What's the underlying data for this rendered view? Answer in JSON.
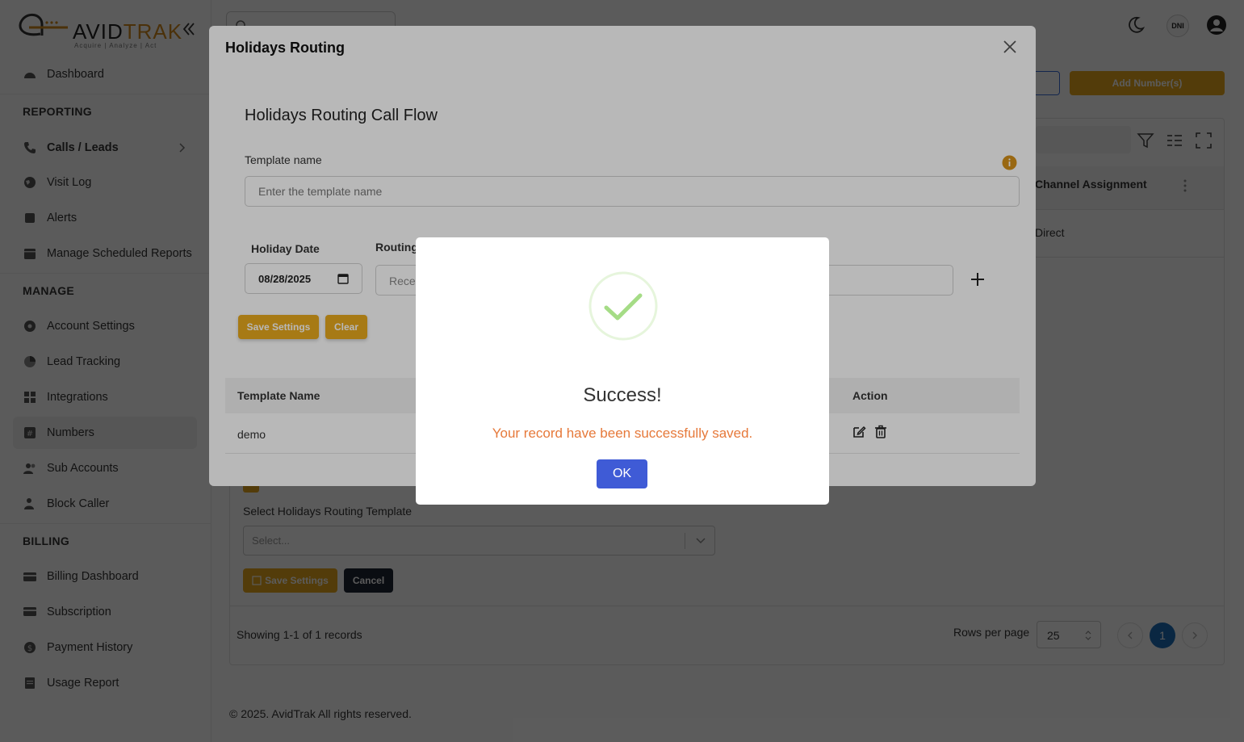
{
  "brand": {
    "name_prefix": "AVID",
    "name_suffix": "TRAK",
    "tagline": "Acquire  |  Analyze  |  Act",
    "accent_color": "#e8a91e"
  },
  "sidebar": {
    "items": [
      {
        "label": "Dashboard",
        "icon": "dashboard-icon"
      },
      {
        "label": "Calls / Leads",
        "icon": "phone-icon"
      },
      {
        "label": "Visit Log",
        "icon": "globe-icon"
      },
      {
        "label": "Alerts",
        "icon": "alert-icon"
      },
      {
        "label": "Manage Scheduled Reports",
        "icon": "calendar-icon"
      },
      {
        "label": "Account Settings",
        "icon": "gear-icon"
      },
      {
        "label": "Lead Tracking",
        "icon": "pie-chart-icon"
      },
      {
        "label": "Integrations",
        "icon": "grid-icon"
      },
      {
        "label": "Numbers",
        "icon": "hash-icon"
      },
      {
        "label": "Sub Accounts",
        "icon": "users-icon"
      },
      {
        "label": "Block Caller",
        "icon": "user-block-icon"
      },
      {
        "label": "Billing Dashboard",
        "icon": "card-icon"
      },
      {
        "label": "Subscription",
        "icon": "subscription-icon"
      },
      {
        "label": "Payment History",
        "icon": "dollar-icon"
      },
      {
        "label": "Usage Report",
        "icon": "report-icon"
      }
    ],
    "sections": {
      "reporting": "REPORTING",
      "manage": "MANAGE",
      "billing": "BILLING"
    }
  },
  "topbar": {
    "dni_label": "DNI"
  },
  "page": {
    "add_number_label": "Add Number(s)",
    "column_channel": "Channel Assignment",
    "cell_channel": "Direct",
    "select_template_label": "Select Holidays Routing Template",
    "select_placeholder": "Select...",
    "save_settings_label": "Save Settings",
    "cancel_label": "Cancel",
    "showing_text": "Showing 1-1 of 1 records",
    "rows_per_page_label": "Rows per page",
    "rows_per_page_value": "25",
    "current_page": "1",
    "copyright": "© 2025. AvidTrak All rights reserved."
  },
  "modal": {
    "title": "Holidays Routing",
    "flow_title": "Holidays Routing Call Flow",
    "template_name_label": "Template name",
    "template_name_placeholder": "Enter the template name",
    "holiday_date_label": "Holiday Date",
    "holiday_date_value": "08/28/2025",
    "routing_label": "Routing",
    "routing_placeholder": "Rece",
    "save_settings_label": "Save Settings",
    "clear_label": "Clear",
    "table": {
      "headers": [
        "Template Name",
        "Action"
      ],
      "rows": [
        {
          "template_name": "demo"
        }
      ]
    }
  },
  "dialog": {
    "title": "Success!",
    "message": "Your record have been successfully saved.",
    "ok_label": "OK",
    "success_color": "#a5dc86",
    "message_color": "#e6793a",
    "button_color": "#3f5bd6"
  }
}
